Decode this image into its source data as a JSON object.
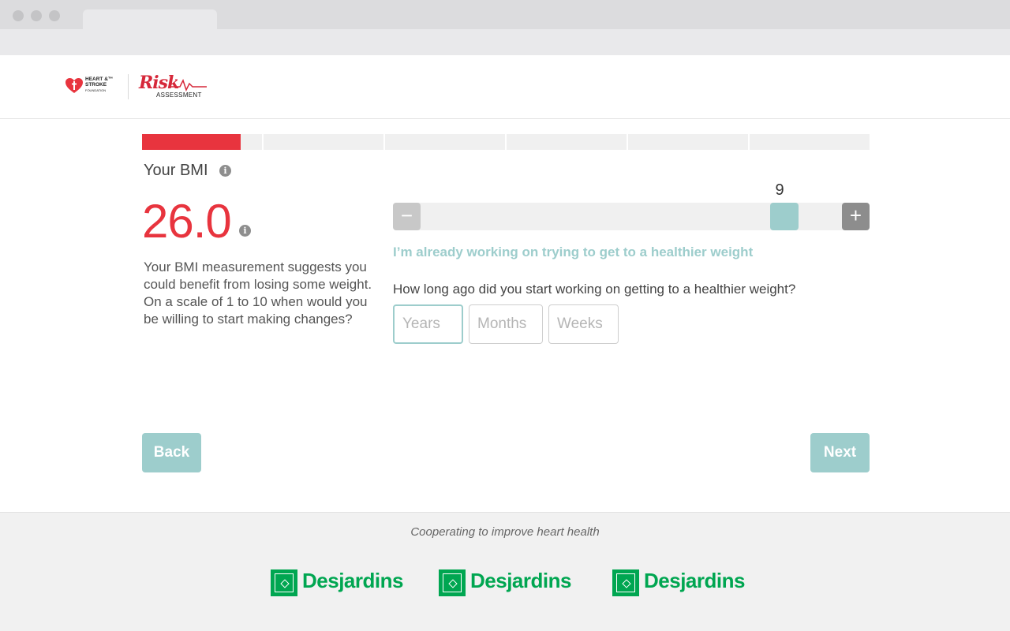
{
  "header": {
    "foundation_line1": "HEART &™",
    "foundation_line2": "STROKE",
    "foundation_line3": "FOUNDATION",
    "app_name_script": "Risk",
    "app_name_sub": "ASSESSMENT"
  },
  "progress": {
    "segments": 6,
    "completed_fraction_of_first": 0.82
  },
  "bmi": {
    "label": "Your BMI",
    "value": "26.0",
    "description": "Your BMI measurement suggests you could benefit from losing some weight. On a scale of 1 to 10 when would you be willing to start making changes?"
  },
  "slider": {
    "min": 1,
    "max": 10,
    "value": 9,
    "value_text": "9",
    "minus_symbol": "−",
    "plus_symbol": "+",
    "stage_label": "I’m already working on trying to get to a healthier weight"
  },
  "duration": {
    "question": "How long ago did you start working on getting to a healthier weight?",
    "years_placeholder": "Years",
    "months_placeholder": "Months",
    "weeks_placeholder": "Weeks"
  },
  "nav": {
    "back_label": "Back",
    "next_label": "Next"
  },
  "footer": {
    "tagline": "Cooperating to improve heart health",
    "sponsors": [
      "Desjardins",
      "Desjardins",
      "Desjardins"
    ]
  },
  "colors": {
    "accent_red": "#e8343e",
    "teal": "#9dcdcc",
    "sponsor_green": "#00a651"
  }
}
